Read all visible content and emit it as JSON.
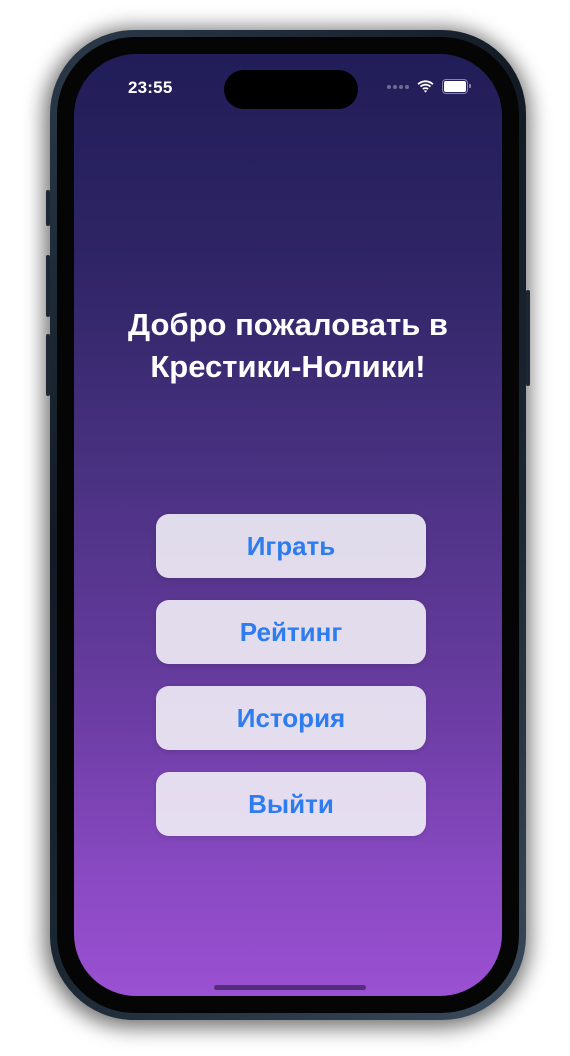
{
  "status_bar": {
    "time": "23:55",
    "icons": [
      "signal-dots-icon",
      "wifi-icon",
      "battery-icon"
    ]
  },
  "main": {
    "title": "Добро пожаловать в Крестики-Нолики!",
    "buttons": [
      {
        "label": "Играть"
      },
      {
        "label": "Рейтинг"
      },
      {
        "label": "История"
      },
      {
        "label": "Выйти"
      }
    ]
  },
  "colors": {
    "background_top": "#211d58",
    "background_bottom": "#9a50d2",
    "button_background": "#eeeaf4",
    "button_text": "#2d7cf0",
    "title_text": "#ffffff"
  }
}
